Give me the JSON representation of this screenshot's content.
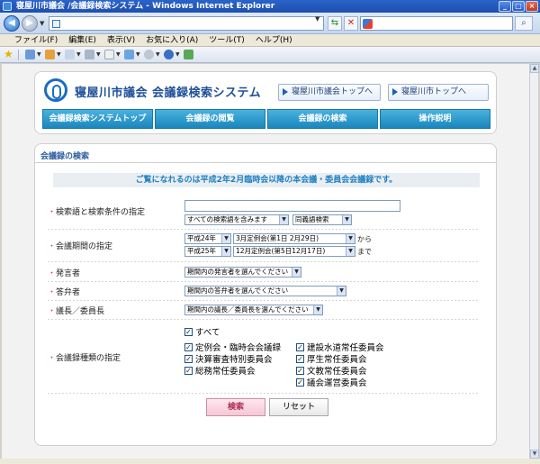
{
  "window": {
    "title": "寝屋川市議会 /会議録検索システム - Windows Internet Explorer",
    "colors": {
      "titlebar": "#1d4fae",
      "accent": "#1a86bd",
      "brand": "#1e4f99"
    }
  },
  "menubar": {
    "items": [
      "ファイル(F)",
      "編集(E)",
      "表示(V)",
      "お気に入り(A)",
      "ツール(T)",
      "ヘルプ(H)"
    ]
  },
  "header": {
    "site_title": "寝屋川市議会 会議録検索システム",
    "link_council_top": "寝屋川市議会トップへ",
    "link_city_top": "寝屋川市トップへ",
    "tabs": [
      "会議録検索システムトップ",
      "会議録の閲覧",
      "会議録の検索",
      "操作説明"
    ]
  },
  "search": {
    "panel_title": "会議録の検索",
    "notice": "ご覧になれるのは平成2年2月臨時会以降の本会議・委員会会議録です。",
    "keyword_label": "検索語と検索条件の指定",
    "keyword_value": "",
    "keyword_mode": "すべての検索語を含みます",
    "synonym_mode": "同義語検索",
    "period_label": "会議期間の指定",
    "from_year": "平成24年",
    "from_session": "3月定例会(第1日 2月29日)",
    "from_suffix": "から",
    "to_year": "平成25年",
    "to_session": "12月定例会(第5日12月17日)",
    "to_suffix": "まで",
    "speaker_label": "発言者",
    "speaker_value": "期間内の発言者を選んでください",
    "answerer_label": "答弁者",
    "answerer_value": "期間内の答弁者を選んでください",
    "chair_label": "議長／委員長",
    "chair_value": "期間内の議長／委員長を選んでください",
    "type_label": "会議録種類の指定",
    "type_all": "すべて",
    "types_left": [
      "定例会・臨時会会議録",
      "決算審査特別委員会",
      "総務常任委員会"
    ],
    "types_right": [
      "建設水道常任委員会",
      "厚生常任委員会",
      "文教常任委員会",
      "議会運営委員会"
    ],
    "search_button": "検索",
    "reset_button": "リセット"
  }
}
